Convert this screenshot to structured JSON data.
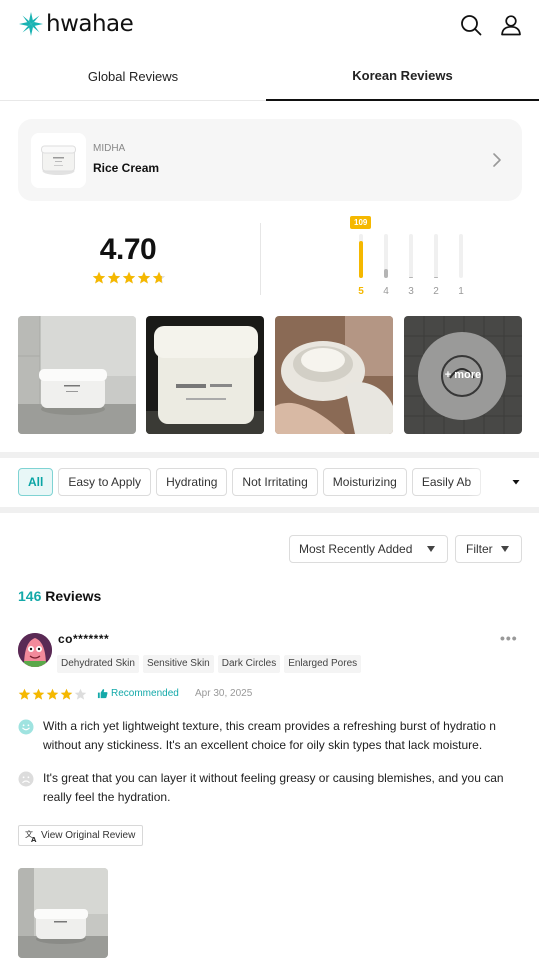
{
  "brand": {
    "name": "hwahae",
    "accent": "#19b3b3"
  },
  "header": {
    "icons": [
      "search-icon",
      "user-icon"
    ]
  },
  "tabs": [
    {
      "label": "Global Reviews",
      "active": false
    },
    {
      "label": "Korean Reviews",
      "active": true
    }
  ],
  "product": {
    "brand": "MIDHA",
    "name": "Rice Cream"
  },
  "rating": {
    "score": "4.70",
    "stars": 4.7,
    "distribution": [
      {
        "label": "5",
        "fraction": 0.85,
        "count_badge": "109",
        "active": true
      },
      {
        "label": "4",
        "fraction": 0.2,
        "active": false
      },
      {
        "label": "3",
        "fraction": 0.03,
        "active": false
      },
      {
        "label": "2",
        "fraction": 0.02,
        "active": false
      },
      {
        "label": "1",
        "fraction": 0.0,
        "active": false
      }
    ],
    "star_color": "#f5b800"
  },
  "photos": {
    "more_label": "+ more"
  },
  "keywords": [
    "All",
    "Easy to Apply",
    "Hydrating",
    "Not Irritating",
    "Moisturizing",
    "Easily Ab"
  ],
  "sort": {
    "label": "Most Recently Added"
  },
  "filter": {
    "label": "Filter"
  },
  "reviews_summary": {
    "count": "146",
    "label": " Reviews"
  },
  "review": {
    "user": "co*******",
    "skin_tags": [
      "Dehydrated Skin",
      "Sensitive Skin",
      "Dark Circles",
      "Enlarged Pores"
    ],
    "stars": 4,
    "recommended_label": "Recommended",
    "date": "Apr 30, 2025",
    "positive": "With a rich yet lightweight texture, this cream provides a refreshing burst of hydratio n without any stickiness. It's an excellent choice for oily skin types that lack moisture.",
    "negative": "It's great that you can layer it without feeling greasy or causing blemishes, and you can really feel the hydration.",
    "view_original_label": "View Original Review"
  }
}
